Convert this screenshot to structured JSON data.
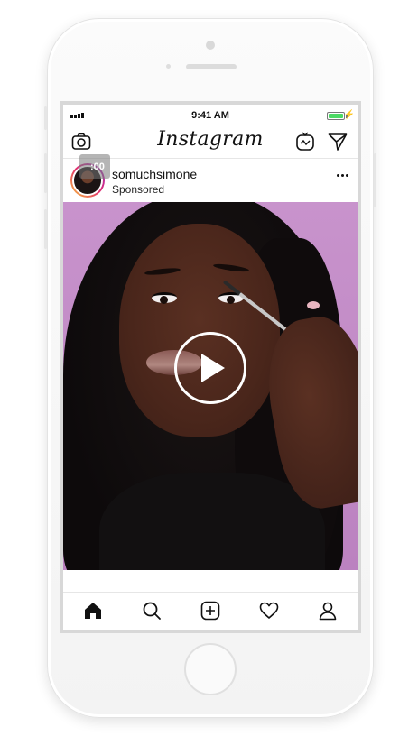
{
  "status_bar": {
    "time": "9:41 AM",
    "battery_level": 1.0,
    "battery_color": "#4cd964"
  },
  "header": {
    "title": "Instagram",
    "left_icon": "camera-icon",
    "right_icons": [
      "igtv-icon",
      "direct-send-icon"
    ]
  },
  "post": {
    "username": "somuchsimone",
    "label": "Sponsored",
    "badge": ":00",
    "more_icon": "more-options-icon",
    "media_type": "video",
    "play_icon": "play-icon"
  },
  "tab_bar": {
    "items": [
      {
        "icon": "home-icon",
        "active": true
      },
      {
        "icon": "search-icon",
        "active": false
      },
      {
        "icon": "new-post-icon",
        "active": false
      },
      {
        "icon": "activity-heart-icon",
        "active": false
      },
      {
        "icon": "profile-icon",
        "active": false
      }
    ]
  },
  "colors": {
    "story_ring": "#e1306c",
    "text": "#111111",
    "divider": "#e6e6e6"
  }
}
